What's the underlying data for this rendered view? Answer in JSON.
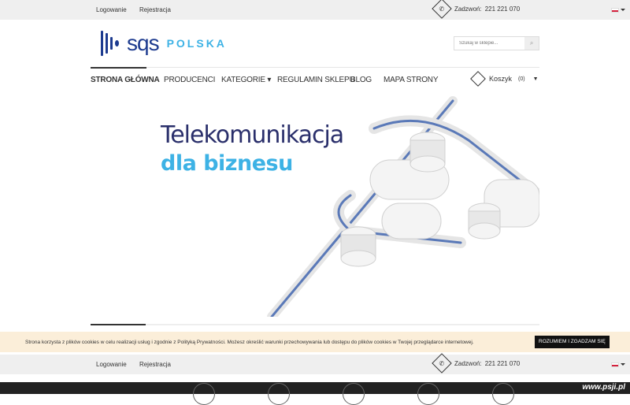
{
  "topbar": {
    "login": "Logowanie",
    "register": "Rejestracja",
    "phone_label": "Zadzwoń:",
    "phone": "221 221 070"
  },
  "logo": {
    "brand": "sqs",
    "sub": "POLSKA"
  },
  "search": {
    "placeholder": "Szukaj w sklepie..."
  },
  "nav": {
    "items": [
      "STRONA GŁÓWNA",
      "PRODUCENCI",
      "KATEGORIE",
      "REGULAMIN SKLEPU",
      "BLOG",
      "MAPA STRONY"
    ]
  },
  "cart": {
    "label": "Koszyk",
    "count": "(0)"
  },
  "hero": {
    "title1": "Telekomunikacja",
    "title2": "dla biznesu"
  },
  "cookie": {
    "text": "Strona korzysta z plików cookies w celu realizacji usług i zgodnie z Polityką Prywatności. Możesz określić warunki przechowywania lub dostępu do plików cookies w Twojej przeglądarce internetowej.",
    "accept": "ROZUMIEM I ZGADZAM SIĘ"
  },
  "watermark": "www.psji.pl",
  "colors": {
    "brand_dark": "#2a2f6b",
    "brand_light": "#3db2e5",
    "cookie_bg": "#fbeed9"
  }
}
